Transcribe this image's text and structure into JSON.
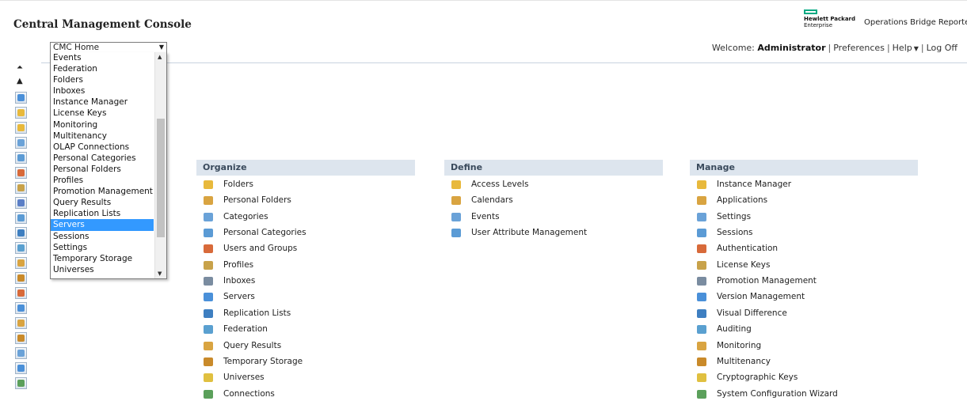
{
  "header": {
    "app_title": "Central Management Console",
    "brand_line1": "Hewlett Packard",
    "brand_line2": "Enterprise",
    "product": "Operations Bridge Reporter"
  },
  "welcome": {
    "prefix": "Welcome:",
    "user": "Administrator",
    "preferences": "Preferences",
    "help": "Help",
    "logoff": "Log Off"
  },
  "nav": {
    "selected_value": "CMC Home",
    "items": [
      "Events",
      "Federation",
      "Folders",
      "Inboxes",
      "Instance Manager",
      "License Keys",
      "Monitoring",
      "Multitenancy",
      "OLAP Connections",
      "Personal Categories",
      "Personal Folders",
      "Profiles",
      "Promotion Management",
      "Query Results",
      "Replication Lists",
      "Servers",
      "Sessions",
      "Settings",
      "Temporary Storage",
      "Universes"
    ],
    "highlighted": "Servers"
  },
  "organize": {
    "title": "Organize",
    "items": [
      "Folders",
      "Personal Folders",
      "Categories",
      "Personal Categories",
      "Users and Groups",
      "Profiles",
      "Inboxes",
      "Servers",
      "Replication Lists",
      "Federation",
      "Query Results",
      "Temporary Storage",
      "Universes",
      "Connections"
    ]
  },
  "define": {
    "title": "Define",
    "items": [
      "Access Levels",
      "Calendars",
      "Events",
      "User Attribute Management"
    ]
  },
  "manage": {
    "title": "Manage",
    "items": [
      "Instance Manager",
      "Applications",
      "Settings",
      "Sessions",
      "Authentication",
      "License Keys",
      "Promotion Management",
      "Version Management",
      "Visual Difference",
      "Auditing",
      "Monitoring",
      "Multitenancy",
      "Cryptographic Keys",
      "System Configuration Wizard"
    ]
  },
  "colors": {
    "accent": "#3399ff",
    "section_bg": "#dde5ee",
    "hpe_green": "#01a982"
  }
}
